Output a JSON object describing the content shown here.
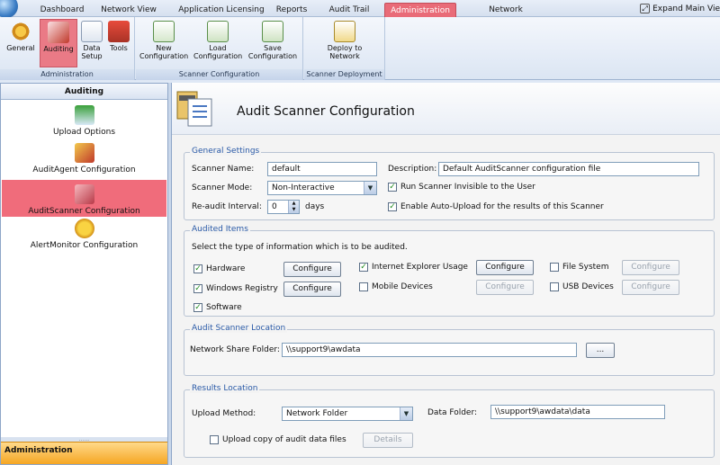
{
  "tabs": [
    "Dashboard",
    "Network View",
    "Application Licensing",
    "Reports",
    "Audit Trail",
    "Administration",
    "Network Discovery"
  ],
  "active_tab": "Administration",
  "expand_label": "Expand Main Vie",
  "ribbon": {
    "administration": {
      "label": "Administration",
      "buttons": [
        "General",
        "Auditing",
        "Data Setup",
        "Tools"
      ]
    },
    "scanner_configuration": {
      "label": "Scanner Configuration",
      "buttons": [
        "New Configuration",
        "Load Configuration",
        "Save Configuration"
      ]
    },
    "scanner_deployment": {
      "label": "Scanner Deployment",
      "buttons": [
        "Deploy to Network"
      ]
    }
  },
  "left_panel": {
    "header": "Auditing",
    "items": [
      "Upload Options",
      "AuditAgent Configuration",
      "AuditScanner Configuration",
      "AlertMonitor Configuration"
    ],
    "footer": "Administration"
  },
  "main": {
    "title": "Audit Scanner Configuration",
    "general": {
      "legend": "General Settings",
      "scanner_name_label": "Scanner Name:",
      "scanner_name": "default",
      "description_label": "Description:",
      "description": "Default AuditScanner configuration file",
      "scanner_mode_label": "Scanner Mode:",
      "scanner_mode": "Non-Interactive",
      "reaudit_label": "Re-audit Interval:",
      "reaudit_value": "0",
      "reaudit_unit": "days",
      "run_invisible_label": "Run Scanner Invisible to the User",
      "run_invisible_checked": true,
      "auto_upload_label": "Enable Auto-Upload for the results of this Scanner",
      "auto_upload_checked": true
    },
    "audited": {
      "legend": "Audited Items",
      "instruction": "Select the type of information which is to be audited.",
      "configure_label": "Configure",
      "items": [
        {
          "label": "Hardware",
          "checked": true,
          "enabled": true
        },
        {
          "label": "Windows Registry",
          "checked": true,
          "enabled": true
        },
        {
          "label": "Software",
          "checked": true
        },
        {
          "label": "Internet Explorer Usage",
          "checked": true,
          "enabled": true
        },
        {
          "label": "Mobile Devices",
          "checked": false,
          "enabled": false
        },
        {
          "label": "File System",
          "checked": false,
          "enabled": false
        },
        {
          "label": "USB Devices",
          "checked": false,
          "enabled": false
        }
      ]
    },
    "location": {
      "legend": "Audit Scanner Location",
      "folder_label": "Network Share Folder:",
      "folder": "\\\\support9\\awdata",
      "browse_label": "..."
    },
    "results": {
      "legend": "Results Location",
      "upload_method_label": "Upload Method:",
      "upload_method": "Network Folder",
      "data_folder_label": "Data Folder:",
      "data_folder": "\\\\support9\\awdata\\data",
      "upload_copy_label": "Upload copy of audit data files",
      "upload_copy_checked": false,
      "details_label": "Details"
    }
  },
  "colors": {
    "accent": "#e96b78",
    "legend": "#2a5aa7",
    "selected": "#f06c7b",
    "footer": "#f5a623"
  }
}
